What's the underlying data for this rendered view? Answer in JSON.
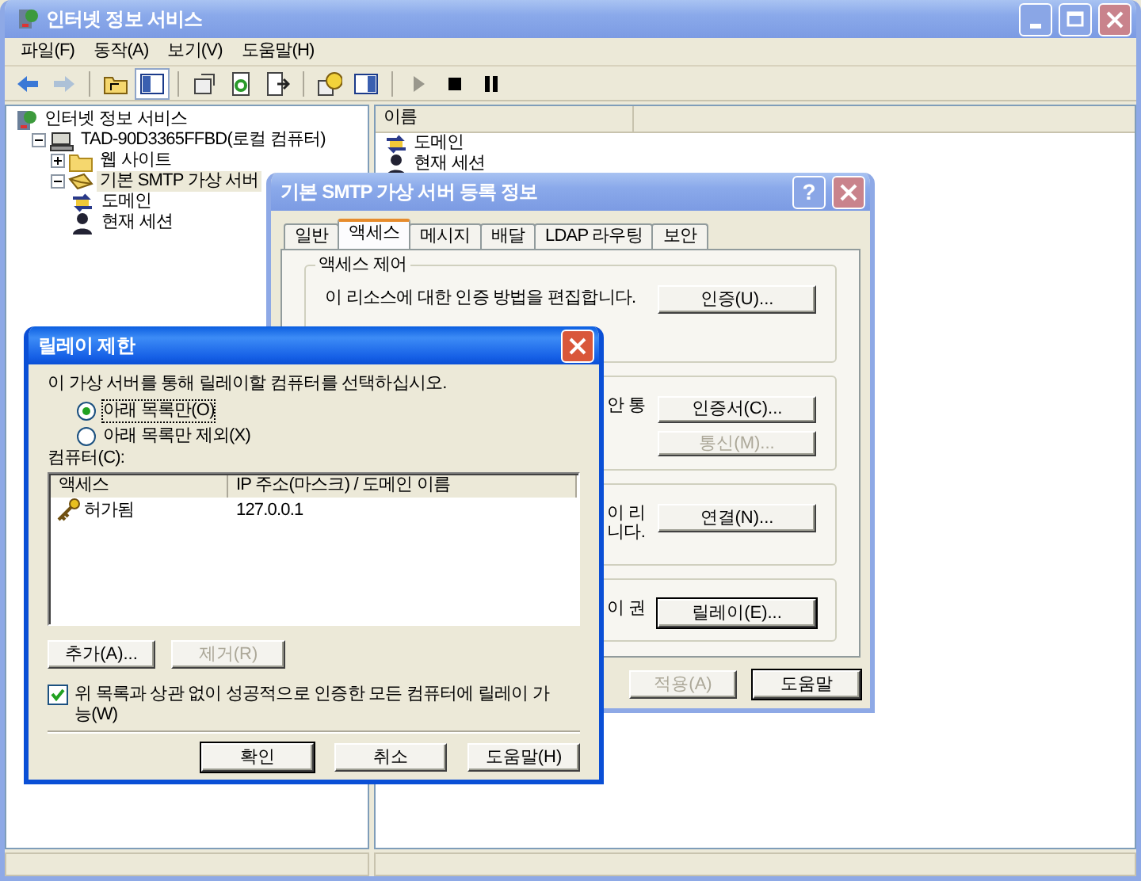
{
  "main_window": {
    "title": "인터넷 정보 서비스",
    "active": false
  },
  "menu": [
    "파일(F)",
    "동작(A)",
    "보기(V)",
    "도움말(H)"
  ],
  "toolbar": [
    {
      "kind": "back",
      "disabled": false,
      "pressed": false
    },
    {
      "kind": "forward",
      "disabled": true,
      "pressed": false
    },
    {
      "kind": "separator"
    },
    {
      "kind": "up",
      "disabled": false,
      "pressed": false
    },
    {
      "kind": "tree",
      "disabled": false,
      "pressed": true
    },
    {
      "kind": "separator"
    },
    {
      "kind": "properties",
      "disabled": false,
      "pressed": false
    },
    {
      "kind": "refresh",
      "disabled": false,
      "pressed": false
    },
    {
      "kind": "export",
      "disabled": false,
      "pressed": false
    },
    {
      "kind": "separator"
    },
    {
      "kind": "help",
      "disabled": false,
      "pressed": false
    },
    {
      "kind": "console",
      "disabled": false,
      "pressed": false
    },
    {
      "kind": "separator"
    },
    {
      "kind": "play",
      "disabled": true,
      "pressed": false
    },
    {
      "kind": "stop",
      "disabled": false,
      "pressed": false
    },
    {
      "kind": "pause",
      "disabled": false,
      "pressed": false
    }
  ],
  "tree": [
    {
      "label": "인터넷 정보 서비스",
      "kind": "server",
      "selected": false,
      "children": [
        {
          "label": "TAD-90D3365FFBD(로컬 컴퓨터)",
          "kind": "computer",
          "expanded": true,
          "selected": false,
          "children": [
            {
              "label": "웹 사이트",
              "kind": "folder",
              "expanded": false,
              "selected": false
            },
            {
              "label": "기본 SMTP 가상 서버",
              "kind": "mail",
              "expanded": true,
              "selected": true,
              "children": [
                {
                  "label": "도메인",
                  "kind": "domain",
                  "selected": false
                },
                {
                  "label": "현재 세션",
                  "kind": "session",
                  "selected": false
                }
              ]
            }
          ]
        }
      ]
    }
  ],
  "list": {
    "columns": [
      "이름"
    ],
    "items": [
      {
        "label": "도메인",
        "kind": "domain"
      },
      {
        "label": "현재 세션",
        "kind": "session"
      }
    ]
  },
  "smtp_dialog": {
    "title": "기본 SMTP 가상 서버 등록 정보",
    "active": false,
    "help_glyph": "?",
    "tabs": [
      {
        "label": "일반",
        "selected": false
      },
      {
        "label": "액세스",
        "selected": true
      },
      {
        "label": "메시지",
        "selected": false
      },
      {
        "label": "배달",
        "selected": false
      },
      {
        "label": "LDAP 라우팅",
        "selected": false
      },
      {
        "label": "보안",
        "selected": false
      }
    ],
    "groups": [
      {
        "kind": "full",
        "title": "액세스 제어",
        "lines": [
          "이 리소스에 대한 인증 방법을 편집합니다."
        ],
        "buttons": [
          {
            "label": "인증(U)...",
            "disabled": false,
            "focused": false
          }
        ]
      },
      {
        "kind": "cut",
        "lines": [
          "안 통"
        ],
        "buttons": [
          {
            "label": "인증서(C)...",
            "disabled": false,
            "focused": false
          },
          {
            "label": "통신(M)...",
            "disabled": true,
            "focused": false
          }
        ]
      },
      {
        "kind": "cut",
        "lines": [
          "이 리",
          "니다."
        ],
        "buttons": [
          {
            "label": "연결(N)...",
            "disabled": false,
            "focused": false
          }
        ]
      },
      {
        "kind": "cut",
        "lines": [
          "이 권"
        ],
        "buttons": [
          {
            "label": "릴레이(E)...",
            "disabled": false,
            "focused": true
          }
        ]
      }
    ],
    "buttons": [
      {
        "label": "적용(A)",
        "disabled": true,
        "focused": false
      },
      {
        "label": "도움말",
        "disabled": false,
        "focused": true
      }
    ]
  },
  "relay_dialog": {
    "title": "릴레이 제한",
    "active": true,
    "prompt": "이 가상 서버를 통해 릴레이할 컴퓨터를 선택하십시오.",
    "options": [
      {
        "label": "아래 목록만(O)",
        "selected": true
      },
      {
        "label": "아래 목록만 제외(X)",
        "selected": false
      }
    ],
    "list_label": "컴퓨터(C):",
    "columns": [
      "액세스",
      "IP 주소(마스크) / 도메인 이름"
    ],
    "rows": [
      {
        "access": "허가됨",
        "address": "127.0.0.1"
      }
    ],
    "list_buttons": [
      {
        "label": "추가(A)...",
        "disabled": false,
        "focused": false
      },
      {
        "label": "제거(R)",
        "disabled": true,
        "focused": false
      }
    ],
    "checkbox": {
      "label": "위 목록과 상관 없이 성공적으로 인증한 모든 컴퓨터에 릴레이 가능(W)",
      "checked": true
    },
    "buttons": [
      {
        "label": "확인",
        "disabled": false,
        "focused": true
      },
      {
        "label": "취소",
        "disabled": false,
        "focused": false
      },
      {
        "label": "도움말(H)",
        "disabled": false,
        "focused": false
      }
    ]
  }
}
